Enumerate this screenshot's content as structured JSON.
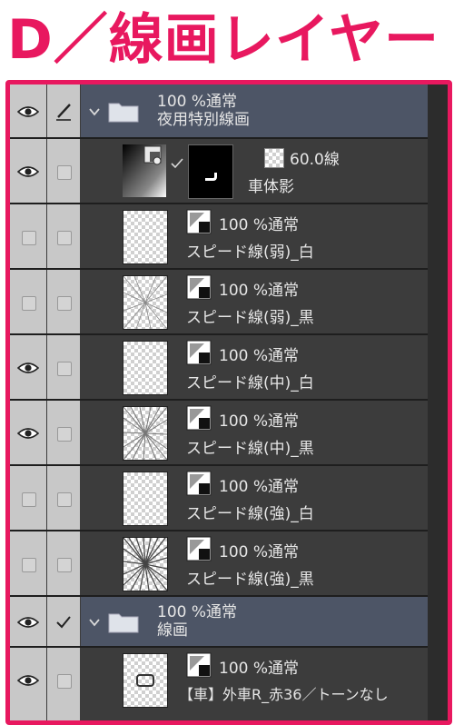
{
  "heading": "D／線画レイヤー",
  "folders": [
    {
      "opacity_mode": "100 %通常",
      "name": "夜用特別線画"
    },
    {
      "opacity_mode": "100 %通常",
      "name": "線画"
    }
  ],
  "mask_layer": {
    "opacity_mode": "60.0線",
    "name": "車体影"
  },
  "layers": [
    {
      "opacity_mode": "100 %通常",
      "name": "スピード線(弱)_白",
      "visible": false
    },
    {
      "opacity_mode": "100 %通常",
      "name": "スピード線(弱)_黒",
      "visible": false
    },
    {
      "opacity_mode": "100 %通常",
      "name": "スピード線(中)_白",
      "visible": true
    },
    {
      "opacity_mode": "100 %通常",
      "name": "スピード線(中)_黒",
      "visible": true
    },
    {
      "opacity_mode": "100 %通常",
      "name": "スピード線(強)_白",
      "visible": false
    },
    {
      "opacity_mode": "100 %通常",
      "name": "スピード線(強)_黒",
      "visible": false
    },
    {
      "opacity_mode": "100 %通常",
      "name": "【車】外車R_赤36／トーンなし",
      "visible": true
    }
  ],
  "colors": {
    "accent": "#e8185f",
    "panel": "#3c3c3c",
    "folder_row": "#4d5566",
    "visibility_column": "#c8c8c8"
  }
}
